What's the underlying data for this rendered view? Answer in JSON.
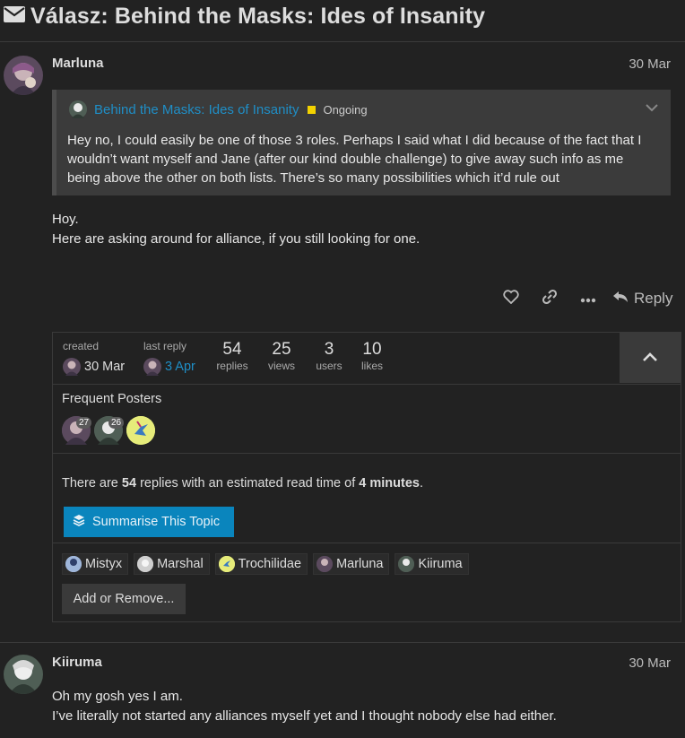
{
  "topic": {
    "title": "Válasz: Behind the Masks: Ides of Insanity",
    "icon": "envelope-icon"
  },
  "post1": {
    "username": "Marluna",
    "date": "30 Mar",
    "quote": {
      "link_title": "Behind the Masks: Ides of Insanity",
      "category": "Ongoing",
      "category_color": "#f3d200",
      "text": "Hey no, I could easily be one of those 3 roles. Perhaps I said what I did because of the fact that I wouldn’t want myself and Jane (after our kind double challenge) to give away such info as me being above the other on both lists. There’s so many possibilities which it’d rule out"
    },
    "body_line1": "Hoy.",
    "body_line2": "Here are asking around for alliance, if you still looking for one.",
    "actions": {
      "reply_label": "Reply"
    }
  },
  "topic_map": {
    "created_label": "created",
    "created_date": "30 Mar",
    "last_reply_label": "last reply",
    "last_reply_date": "3 Apr",
    "stats": [
      {
        "value": "54",
        "label": "replies"
      },
      {
        "value": "25",
        "label": "views"
      },
      {
        "value": "3",
        "label": "users"
      },
      {
        "value": "10",
        "label": "likes"
      }
    ],
    "frequent_posters_label": "Frequent Posters",
    "frequent_badges": [
      "27",
      "26"
    ],
    "summary_pre": "There are ",
    "summary_count": "54",
    "summary_mid": " replies with an estimated read time of ",
    "summary_time": "4 minutes",
    "summary_post": ".",
    "summarise_label": "Summarise This Topic",
    "participants": [
      "Mistyx",
      "Marshal",
      "Trochilidae",
      "Marluna",
      "Kiiruma"
    ],
    "add_remove_label": "Add or Remove..."
  },
  "post2": {
    "username": "Kiiruma",
    "date": "30 Mar",
    "body_line1": "Oh my gosh yes I am.",
    "body_line2": "I’ve literally not started any alliances myself yet and I thought nobody else had either."
  },
  "colors": {
    "background": "#222222",
    "link": "#1f8ec6",
    "primary_button": "#0a85bd"
  }
}
